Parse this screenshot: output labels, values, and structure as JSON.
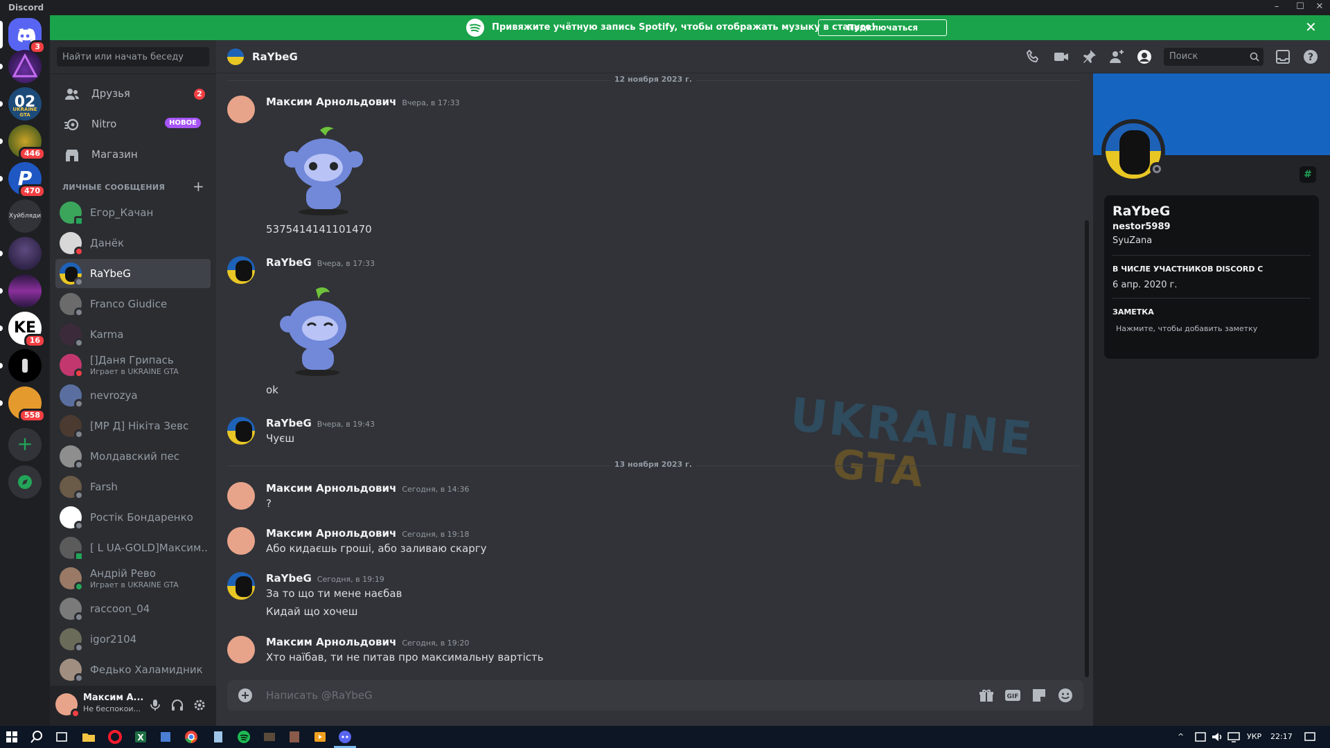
{
  "window": {
    "title": "Discord"
  },
  "server_badges": [
    "3",
    "446",
    "470",
    "16",
    "558"
  ],
  "server_label_text": "Хуйбляди",
  "spotify_banner": {
    "message": "Привяжите учётную запись Spotify, чтобы отображать музыку в статусе!",
    "button": "Подключаться",
    "color": "#1aa34a"
  },
  "dm_sidebar": {
    "search_placeholder": "Найти или начать беседу",
    "nav": [
      {
        "label": "Друзья",
        "badge": "2"
      },
      {
        "label": "Nitro",
        "badge": "НОВОЕ"
      },
      {
        "label": "Магазин"
      }
    ],
    "section_header": "ЛИЧНЫЕ СООБЩЕНИЯ",
    "dms": [
      {
        "name": "Егор_Качан",
        "status": "mobile-online"
      },
      {
        "name": "Данёк",
        "status": "dnd"
      },
      {
        "name": "RaYbeG",
        "status": "offline"
      },
      {
        "name": "Franco Giudice",
        "status": "offline"
      },
      {
        "name": "Karma",
        "status": "offline"
      },
      {
        "name": "[]Даня Грипась",
        "sub": "Играет в UKRAINE GTA",
        "status": "dnd"
      },
      {
        "name": "nevrozya",
        "status": "offline"
      },
      {
        "name": "[MP Д] Нікіта Зевс",
        "status": "offline"
      },
      {
        "name": "Молдавский пес",
        "status": "offline"
      },
      {
        "name": "Farsh",
        "status": "offline"
      },
      {
        "name": "Ростік Бондаренко",
        "status": "offline"
      },
      {
        "name": "[ L UA-GOLD]Максим...",
        "status": "mobile-online"
      },
      {
        "name": "Андрій Рево",
        "sub": "Играет в UKRAINE GTA",
        "status": "online"
      },
      {
        "name": "raccoon_04",
        "status": "offline"
      },
      {
        "name": "igor2104",
        "status": "offline"
      },
      {
        "name": "Федько Халамидник",
        "status": "offline"
      }
    ]
  },
  "user_panel": {
    "name": "Максим А...",
    "status": "Не беспокои..."
  },
  "chat_header": {
    "name": "RaYbeG",
    "search_placeholder": "Поиск"
  },
  "chat": {
    "dates": [
      "12 ноября 2023 г.",
      "13 ноября 2023 г."
    ],
    "messages": [
      {
        "author": "Максим Арнольдович",
        "time": "Вчера, в 17:33",
        "lines": [
          "5375414141101470"
        ],
        "sticker": true
      },
      {
        "author": "RaYbeG",
        "time": "Вчера, в 17:33",
        "lines": [
          "ok"
        ],
        "sticker": true
      },
      {
        "author": "RaYbeG",
        "time": "Вчера, в 19:43",
        "lines": [
          "Чуєш"
        ]
      },
      {
        "author": "Максим Арнольдович",
        "time": "Сегодня, в 14:36",
        "lines": [
          "?"
        ]
      },
      {
        "author": "Максим Арнольдович",
        "time": "Сегодня, в 19:18",
        "lines": [
          "Або кидаєшь гроші, або заливаю скаргу"
        ]
      },
      {
        "author": "RaYbeG",
        "time": "Сегодня, в 19:19",
        "lines": [
          "За то що ти мене наєбав",
          "Кидай що хочеш"
        ]
      },
      {
        "author": "Максим Арнольдович",
        "time": "Сегодня, в 19:20",
        "lines": [
          "Хто наїбав, ти не питав про максимальну вартість"
        ]
      }
    ],
    "composer_placeholder": "Написать @RaYbeG",
    "watermark": [
      "UKRAINE",
      "GTA"
    ]
  },
  "profile": {
    "display_name": "RaYbeG",
    "username": "nestor5989",
    "pronouns": "SyuZana",
    "member_since_label": "В ЧИСЛЕ УЧАСТНИКОВ DISCORD С",
    "member_since": "6 апр. 2020 г.",
    "note_label": "ЗАМЕТКА",
    "note_placeholder": "Нажмите, чтобы добавить заметку",
    "banner_color": "#1565c0"
  },
  "taskbar": {
    "lang": "УКР",
    "time": "22:17"
  }
}
